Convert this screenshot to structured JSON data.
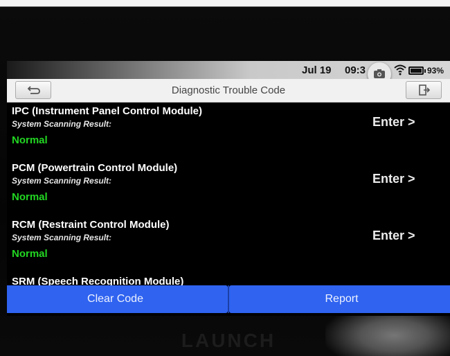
{
  "status_bar": {
    "date": "Jul 19",
    "time": "09:3",
    "battery": "93%"
  },
  "title_bar": {
    "title": "Diagnostic Trouble Code"
  },
  "modules": [
    {
      "name": "IPC (Instrument Panel Control Module)",
      "label": "System Scanning Result:",
      "status": "Normal",
      "action": "Enter >"
    },
    {
      "name": "PCM (Powertrain Control Module)",
      "label": "System Scanning Result:",
      "status": "Normal",
      "action": "Enter >"
    },
    {
      "name": "RCM (Restraint Control Module)",
      "label": "System Scanning Result:",
      "status": "Normal",
      "action": "Enter >"
    },
    {
      "name": "SRM (Speech Recognition Module)"
    }
  ],
  "buttons": {
    "clear_code": "Clear Code",
    "report": "Report"
  },
  "device": {
    "brand": "LAUNCH"
  },
  "colors": {
    "status_normal": "#22d622",
    "button_blue": "#2f63f0"
  }
}
